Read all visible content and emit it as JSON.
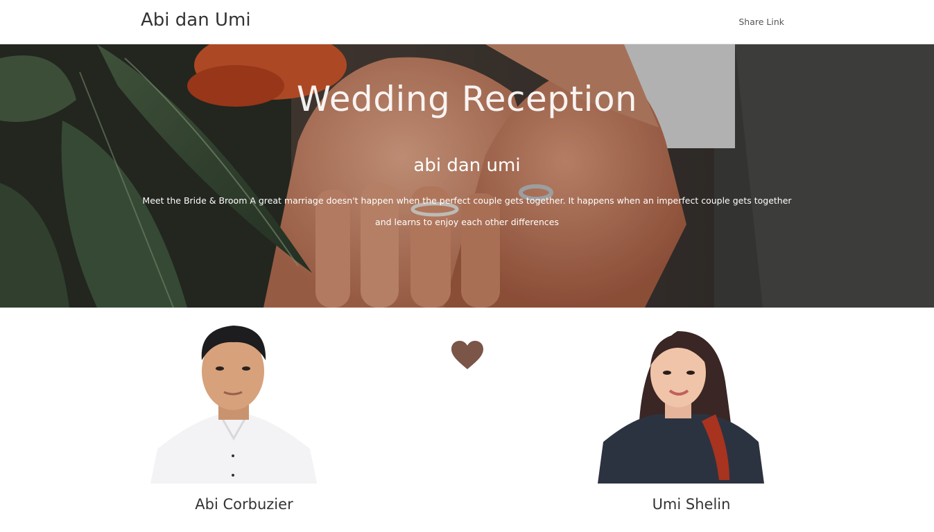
{
  "navbar": {
    "brand": "Abi dan Umi",
    "share_link": "Share Link"
  },
  "hero": {
    "title": "Wedding Reception",
    "subtitle": "abi dan umi",
    "description": "Meet the Bride & Broom A great marriage doesn't happen when the perfect couple gets together. It happens when an imperfect couple gets together and learns to enjoy each other differences"
  },
  "couple": {
    "groom_name": "Abi Corbuzier",
    "bride_name": "Umi Shelin"
  },
  "icons": {
    "separator": "heart-icon"
  },
  "colors": {
    "heart": "#7a5548",
    "progress": "#1a6f8a"
  }
}
